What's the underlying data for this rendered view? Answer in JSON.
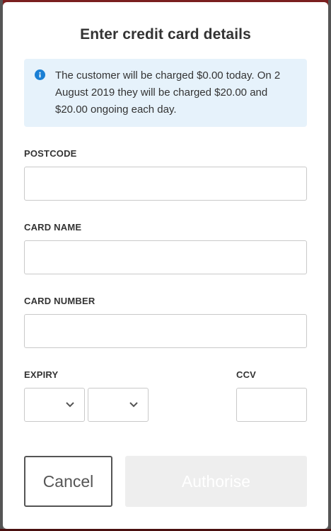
{
  "modal": {
    "title": "Enter credit card details",
    "info_text": "The customer will be charged $0.00 today. On 2 August 2019 they will be charged $20.00 and $20.00 ongoing each day.",
    "fields": {
      "postcode": {
        "label": "POSTCODE",
        "value": ""
      },
      "card_name": {
        "label": "CARD NAME",
        "value": ""
      },
      "card_number": {
        "label": "CARD NUMBER",
        "value": ""
      },
      "expiry": {
        "label": "EXPIRY",
        "month": "",
        "year": ""
      },
      "ccv": {
        "label": "CCV",
        "value": ""
      }
    },
    "buttons": {
      "cancel": "Cancel",
      "authorise": "Authorise"
    }
  },
  "colors": {
    "info_background": "#e6f2fb",
    "info_icon": "#1a7fd4",
    "authorise_disabled": "#eeeeee"
  },
  "icons": [
    "info-icon",
    "chevron-down-icon"
  ]
}
